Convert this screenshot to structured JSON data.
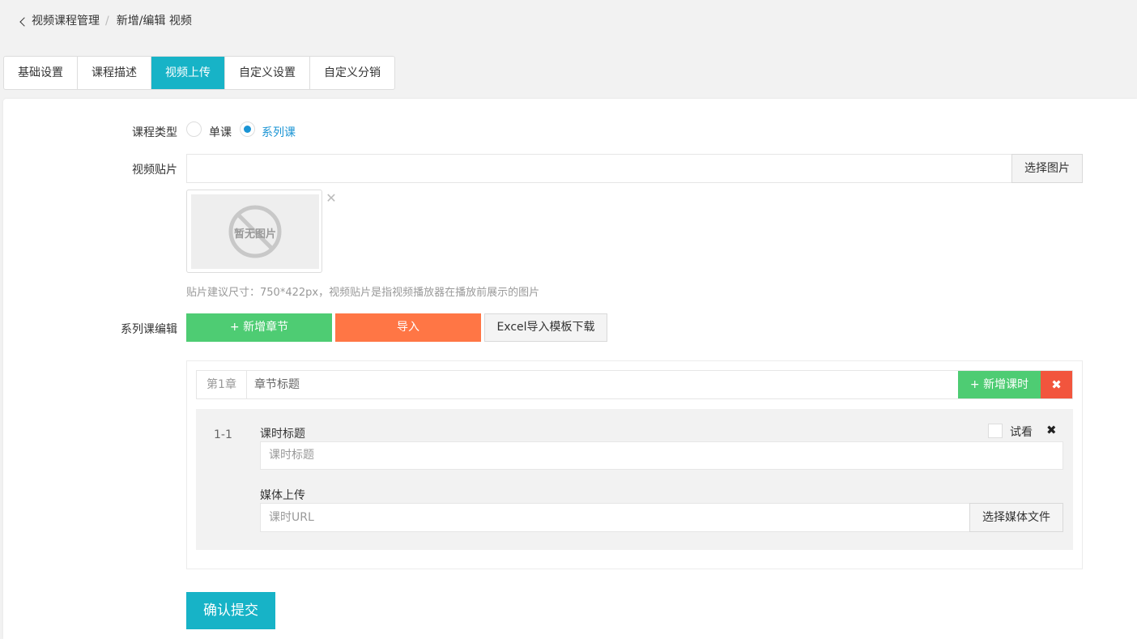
{
  "breadcrumb": {
    "parent": "视频课程管理",
    "separator": "/",
    "current": "新增/编辑 视频"
  },
  "tabs": [
    {
      "label": "基础设置"
    },
    {
      "label": "课程描述"
    },
    {
      "label": "视频上传",
      "active": true
    },
    {
      "label": "自定义设置"
    },
    {
      "label": "自定义分销"
    }
  ],
  "form": {
    "course_type": {
      "label": "课程类型",
      "options": [
        {
          "label": "单课",
          "checked": false
        },
        {
          "label": "系列课",
          "checked": true
        }
      ]
    },
    "poster": {
      "label": "视频贴片",
      "value": "",
      "select_button": "选择图片",
      "no_image_text": "暂无图片",
      "remove_icon": "close-icon",
      "hint": "贴片建议尺寸：750*422px，视频贴片是指视频播放器在播放前展示的图片"
    },
    "series_edit": {
      "label": "系列课编辑",
      "add_chapter_button": "+ 新增章节",
      "import_button": "导入",
      "template_button": "Excel导入模板下载"
    },
    "chapters": [
      {
        "number": "第1章",
        "title_placeholder": "章节标题",
        "add_lesson_button": "+ 新增课时",
        "delete_icon": "close-icon",
        "lessons": [
          {
            "index": "1-1",
            "title_label": "课时标题",
            "title_placeholder": "课时标题",
            "trial_label": "试看",
            "trial_checked": false,
            "delete_icon": "close-icon",
            "media_label": "媒体上传",
            "media_placeholder": "课时URL",
            "media_button": "选择媒体文件"
          }
        ]
      }
    ],
    "submit_button": "确认提交"
  },
  "colors": {
    "accent": "#17b3c7",
    "green": "#4ecc73",
    "orange": "#ff7645",
    "red": "#f2553d",
    "radio_checked": "#1a94d4"
  }
}
